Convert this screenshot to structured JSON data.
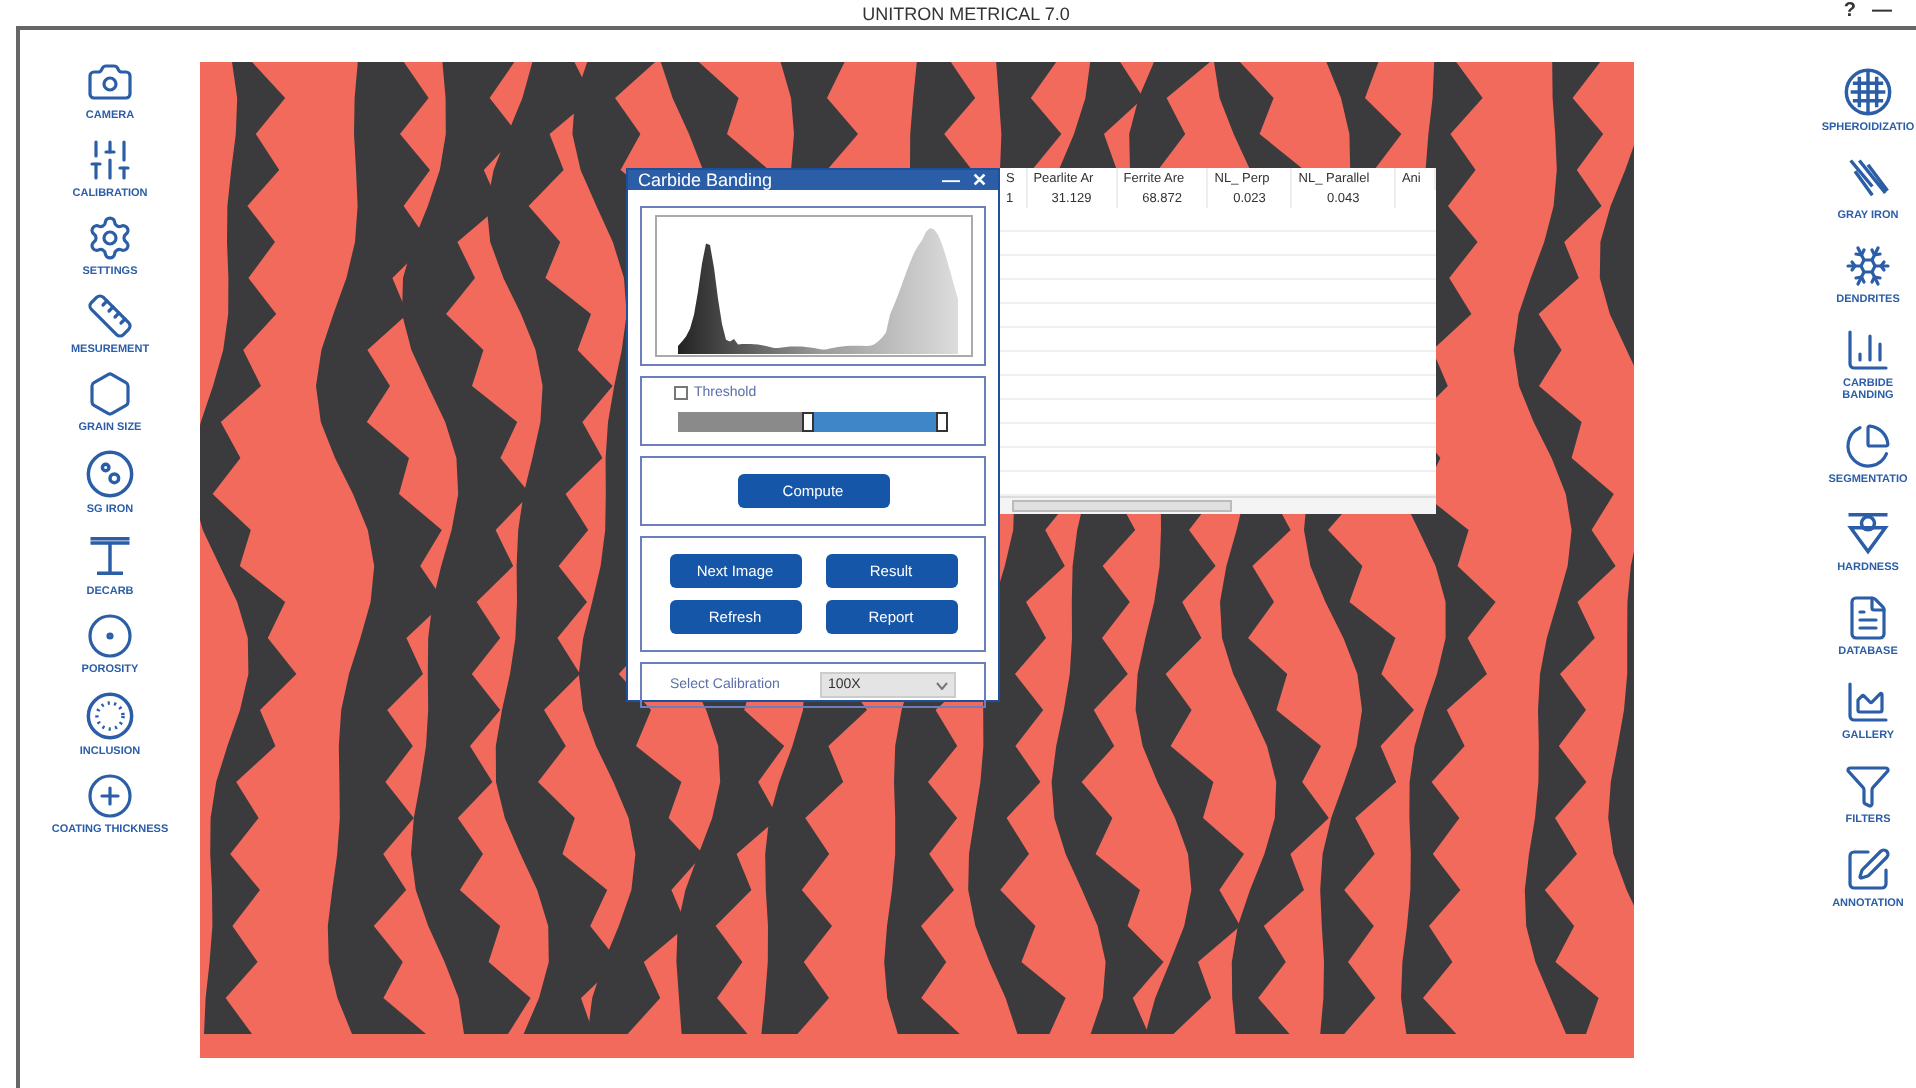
{
  "window": {
    "title": "UNITRON METRICAL 7.0",
    "help": "?",
    "minimize": "—"
  },
  "left_tools": [
    {
      "label": "CAMERA"
    },
    {
      "label": "CALIBRATION"
    },
    {
      "label": "SETTINGS"
    },
    {
      "label": "MESUREMENT"
    },
    {
      "label": "GRAIN SIZE"
    },
    {
      "label": "SG IRON"
    },
    {
      "label": "DECARB"
    },
    {
      "label": "POROSITY"
    },
    {
      "label": "INCLUSION"
    },
    {
      "label": "COATING THICKNESS"
    }
  ],
  "right_tools": [
    {
      "label": "SPHEROIDIZATIO"
    },
    {
      "label": "GRAY IRON"
    },
    {
      "label": "DENDRITES"
    },
    {
      "label": "CARBIDE BANDING"
    },
    {
      "label": "SEGMENTATIO"
    },
    {
      "label": "HARDNESS"
    },
    {
      "label": "DATABASE"
    },
    {
      "label": "GALLERY"
    },
    {
      "label": "FILTERS"
    },
    {
      "label": "ANNOTATION"
    }
  ],
  "dialog": {
    "title": "Carbide Banding",
    "minimize": "—",
    "close": "✕",
    "threshold": {
      "label": "Threshold",
      "checked": false,
      "level": 0.47
    },
    "compute": "Compute",
    "buttons": [
      "Next Image",
      "Result",
      "Refresh",
      "Report"
    ],
    "calibration": {
      "label": "Select Calibration",
      "value": "100X"
    }
  },
  "results": {
    "columns": [
      "S",
      "Pearlite Ar",
      "Ferrite Are",
      "NL_ Perp",
      "NL_ Parallel",
      "Ani"
    ],
    "rows": [
      [
        "1",
        "31.129",
        "68.872",
        "0.023",
        "0.043"
      ]
    ]
  }
}
